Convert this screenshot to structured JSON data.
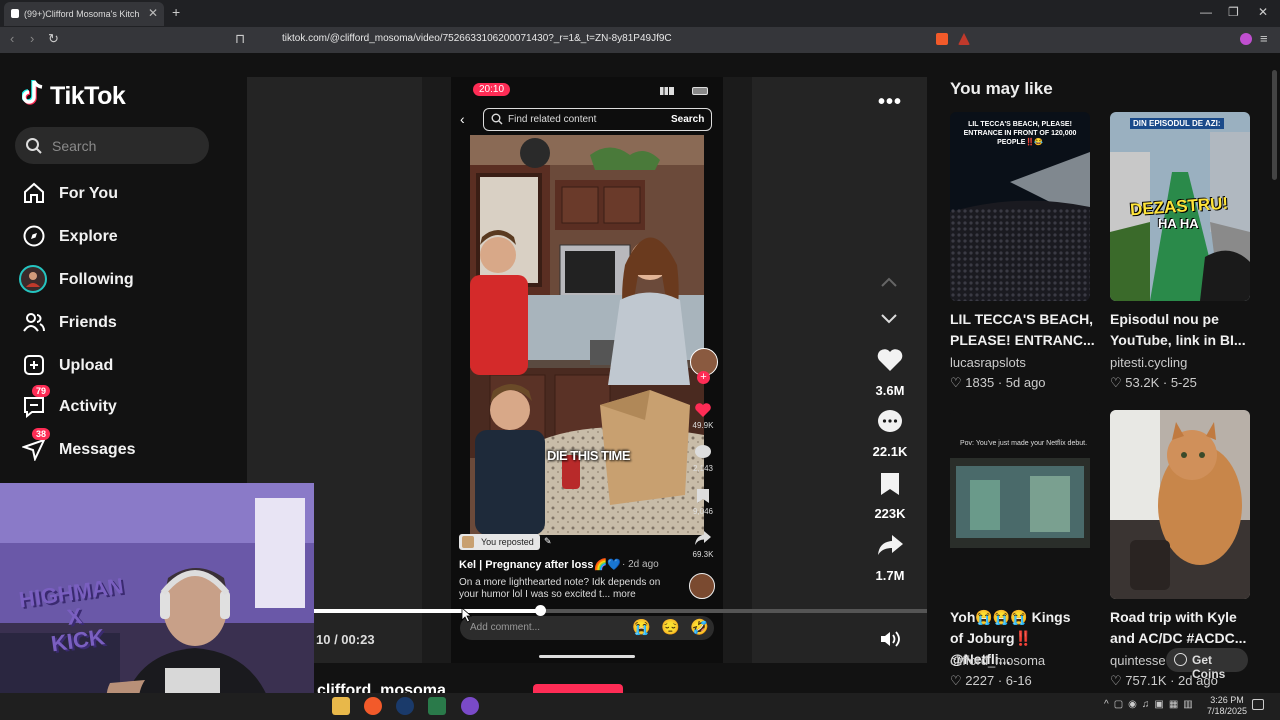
{
  "browser": {
    "tab_title": "(99+)Clifford Mosoma's Kitch",
    "tab_close": "✕",
    "new_tab": "+",
    "url": "tiktok.com/@clifford_mosoma/video/7526633106200071430?_r=1&_t=ZN-8y81P49Jf9C",
    "minimize": "—",
    "restore": "❐",
    "close": "✕"
  },
  "sidebar": {
    "logo": "TikTok",
    "search_placeholder": "Search",
    "items": [
      {
        "label": "For You",
        "icon": "home-icon"
      },
      {
        "label": "Explore",
        "icon": "compass-icon"
      },
      {
        "label": "Following",
        "icon": "avatar-icon"
      },
      {
        "label": "Friends",
        "icon": "friends-icon"
      },
      {
        "label": "Upload",
        "icon": "plus-square-icon"
      },
      {
        "label": "Activity",
        "icon": "inbox-icon",
        "badge": "79"
      },
      {
        "label": "Messages",
        "icon": "send-icon",
        "badge": "38"
      }
    ]
  },
  "phone": {
    "time": "20:10",
    "search_placeholder": "Find related content",
    "search_button": "Search",
    "caption": "DIE THIS TIME",
    "like_count": "49.9K",
    "comment_count": "2,143",
    "save_count": "9,046",
    "share_count": "69.3K",
    "repost_label": "You reposted",
    "author": "Kel | Pregnancy after loss🌈💙",
    "date": "· 2d ago",
    "description": "On a more lighthearted note? Idk depends on your humor lol I was so excited t... more",
    "comment_placeholder": "Add comment...",
    "emojis": [
      "😭",
      "😔",
      "🤣"
    ]
  },
  "player": {
    "progress": 0.37,
    "time": "10 / 00:23",
    "more": "•••",
    "likes": "3.6M",
    "comments": "22.1K",
    "saves": "223K",
    "shares": "1.7M",
    "author_name": "clifford_mosoma"
  },
  "recommend": {
    "heading": "You may like",
    "cards": [
      {
        "overlay": "LIL TECCA'S BEACH, PLEASE! ENTRANCE IN FRONT OF 120,000 PEOPLE‼️😂",
        "title": "LIL TECCA'S BEACH, PLEASE! ENTRANC...",
        "author": "lucasrapslots",
        "likes": "1835",
        "date": "5d ago"
      },
      {
        "overlay": "DIN EPISODUL DE AZI:",
        "overlay2": "DEZASTRU!",
        "overlay3": "HA HA",
        "title": "Episodul nou pe YouTube, link in BI...",
        "author": "pitesti.cycling",
        "likes": "53.2K",
        "date": "5-25"
      },
      {
        "overlay": "Pov: You've just made your Netflix debut.",
        "title": "Yoh😭😭😭 Kings",
        "title2": "of Joburg‼️ @Netfli...",
        "author": "clifford_mosoma",
        "likes": "2227",
        "date": "6-16"
      },
      {
        "title": "Road trip with Kyle",
        "title2": "and AC/DC #ACDC...",
        "author": "quintesse",
        "likes": "757.1K",
        "date": "2d ago"
      }
    ],
    "get_coins": "Get Coins"
  },
  "webcam": {
    "text1": "HIGHMAN",
    "text2": "X",
    "text3": "KICK"
  },
  "taskbar": {
    "time": "3:26 PM",
    "date": "7/18/2025"
  },
  "colors": {
    "accent": "#fe2c55",
    "bg": "#121212"
  }
}
